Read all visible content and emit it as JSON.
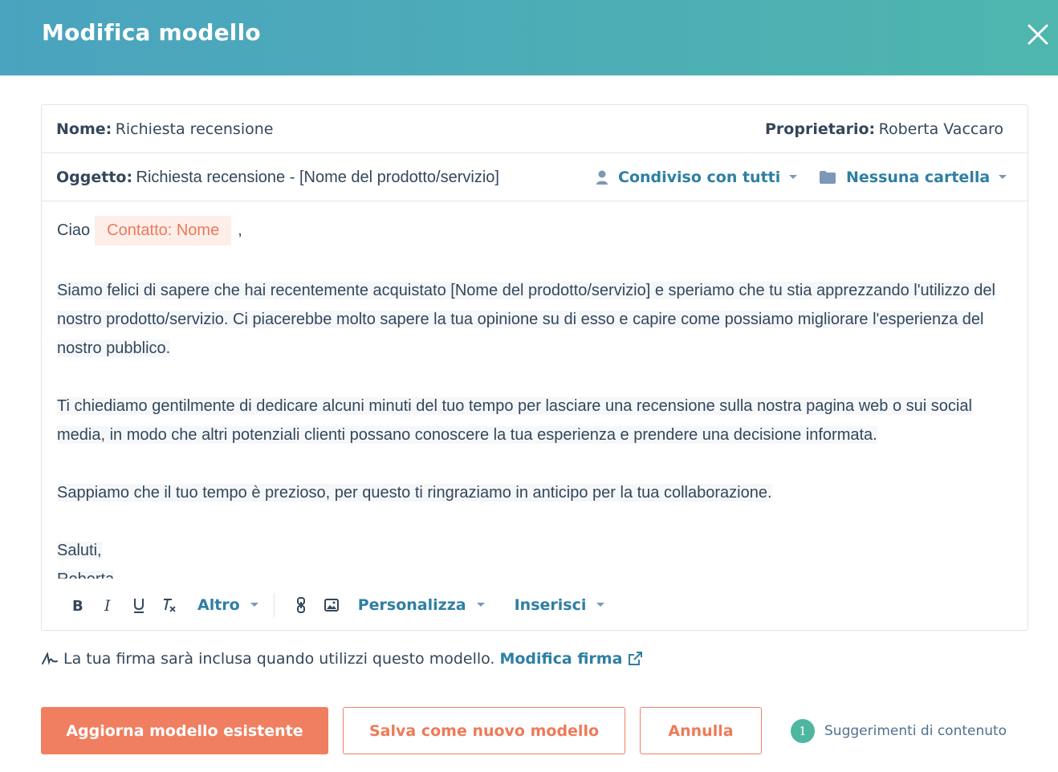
{
  "header": {
    "title": "Modifica modello",
    "close_icon": "close-icon",
    "gradient": [
      "#4aa3bf",
      "#4fb6ae"
    ]
  },
  "fields": {
    "name_label": "Nome:",
    "name_value": "Richiesta recensione",
    "owner_label": "Proprietario:",
    "owner_value": "Roberta Vaccaro",
    "subject_label": "Oggetto:",
    "subject_value": "Richiesta recensione - [Nome del prodotto/servizio]",
    "sharing": {
      "icon": "user-icon",
      "label": "Condiviso con tutti"
    },
    "folder": {
      "icon": "folder-icon",
      "label": "Nessuna cartella"
    }
  },
  "body": {
    "greeting": "Ciao",
    "token": "Contatto: Nome",
    "greeting_suffix": ",",
    "paragraph1": "Siamo felici di sapere che hai recentemente acquistato [Nome del prodotto/servizio] e speriamo che tu stia apprezzando l'utilizzo del nostro prodotto/servizio. Ci piacerebbe molto sapere la tua opinione su di esso e capire come possiamo migliorare l'esperienza del nostro pubblico.",
    "paragraph2": "Ti chiediamo gentilmente di dedicare alcuni minuti del tuo tempo per lasciare una recensione sulla nostra pagina web o sui social media, in modo che altri potenziali clienti possano conoscere la tua esperienza e prendere una decisione informata.",
    "paragraph3": "Sappiamo che il tuo tempo è prezioso, per questo ti ringraziamo in anticipo per la tua collaborazione.",
    "closing": "Saluti,",
    "signature_name": "Roberta"
  },
  "toolbar": {
    "icons": [
      "bold-icon",
      "italic-icon",
      "underline-icon",
      "clear-format-icon",
      "link-icon",
      "image-icon"
    ],
    "more_label": "Altro",
    "personalize_label": "Personalizza",
    "insert_label": "Inserisci"
  },
  "signature_note": {
    "icon": "signature-icon",
    "text": "La tua firma sarà inclusa quando utilizzi questo modello.",
    "link_label": "Modifica firma",
    "link_icon": "external-link-icon"
  },
  "actions": {
    "update_label": "Aggiorna modello esistente",
    "save_new_label": "Salva come nuovo modello",
    "cancel_label": "Annulla",
    "suggestions_count": "1",
    "suggestions_label": "Suggerimenti di contenuto"
  },
  "colors": {
    "accent_blue": "#2e7fa2",
    "primary_orange": "#f07f61",
    "token_bg": "#fdeeea",
    "text": "#33475b",
    "badge": "#4fb6a0"
  }
}
